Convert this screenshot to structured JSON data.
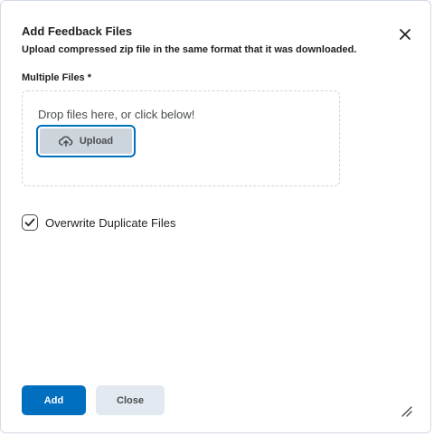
{
  "dialog": {
    "title": "Add Feedback Files",
    "subtitle": "Upload compressed zip file in the same format that it was downloaded.",
    "close_icon": "close-icon"
  },
  "upload": {
    "label": "Multiple Files *",
    "drop_text": "Drop files here, or click below!",
    "button_label": "Upload",
    "button_icon": "cloud-upload-icon"
  },
  "options": {
    "overwrite_label": "Overwrite Duplicate Files",
    "overwrite_checked": true
  },
  "footer": {
    "add_label": "Add",
    "close_label": "Close"
  },
  "colors": {
    "primary": "#006fbf",
    "secondary_button": "#e3e9f1",
    "text": "#202122"
  }
}
